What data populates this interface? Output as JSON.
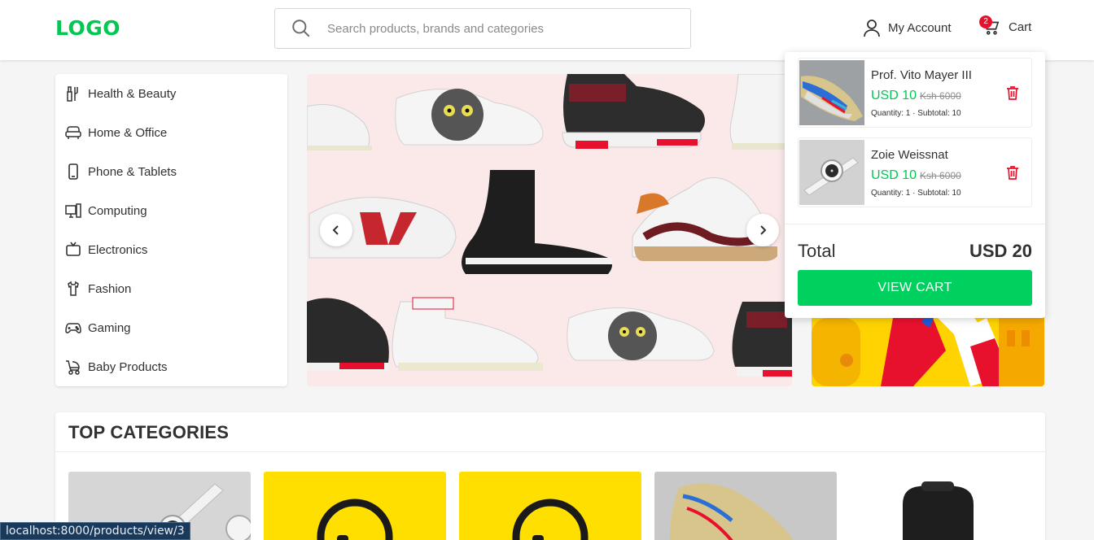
{
  "header": {
    "logo": "LOGO",
    "search_placeholder": "Search products, brands and categories",
    "account_label": "My Account",
    "cart_label": "Cart",
    "cart_count": "2"
  },
  "sidebar": {
    "items": [
      {
        "label": "Health & Beauty",
        "icon": "health-beauty-icon"
      },
      {
        "label": "Home & Office",
        "icon": "home-office-icon"
      },
      {
        "label": "Phone & Tablets",
        "icon": "phone-icon"
      },
      {
        "label": "Computing",
        "icon": "computer-icon"
      },
      {
        "label": "Electronics",
        "icon": "tv-icon"
      },
      {
        "label": "Fashion",
        "icon": "shirt-icon"
      },
      {
        "label": "Gaming",
        "icon": "gamepad-icon"
      },
      {
        "label": "Baby Products",
        "icon": "stroller-icon"
      }
    ]
  },
  "cart_dropdown": {
    "items": [
      {
        "name": "Prof. Vito Mayer III",
        "price": "USD 10",
        "old_price": "Ksh 6000",
        "meta": "Quantity: 1 · Subtotal: 10"
      },
      {
        "name": "Zoie Weissnat",
        "price": "USD 10",
        "old_price": "Ksh 6000",
        "meta": "Quantity: 1 · Subtotal: 10"
      }
    ],
    "total_label": "Total",
    "total_value": "USD 20",
    "view_cart_label": "VIEW CART"
  },
  "top_categories": {
    "title": "TOP CATEGORIES"
  },
  "status_url": "localhost:8000/products/view/3",
  "colors": {
    "accent": "#00c853",
    "button": "#00d15e",
    "badge": "#e8112d",
    "trash": "#e8112d"
  }
}
